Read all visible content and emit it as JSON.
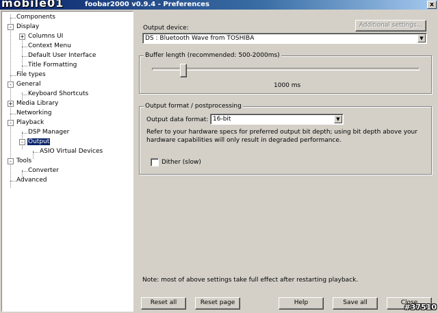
{
  "window": {
    "watermark_logo": "mobile01",
    "title": "foobar2000 v0.9.4 - Preferences",
    "close_label": "x"
  },
  "tree": {
    "items": [
      {
        "label": "Components"
      },
      {
        "label": "Display",
        "expander": "-"
      },
      {
        "label": "Columns UI",
        "expander": "+"
      },
      {
        "label": "Context Menu"
      },
      {
        "label": "Default User Interface"
      },
      {
        "label": "Title Formatting"
      },
      {
        "label": "File types"
      },
      {
        "label": "General",
        "expander": "-"
      },
      {
        "label": "Keyboard Shortcuts"
      },
      {
        "label": "Media Library",
        "expander": "+"
      },
      {
        "label": "Networking"
      },
      {
        "label": "Playback",
        "expander": "-"
      },
      {
        "label": "DSP Manager"
      },
      {
        "label": "Output",
        "expander": "-",
        "selected": true
      },
      {
        "label": "ASIO Virtual Devices"
      },
      {
        "label": "Tools",
        "expander": "-"
      },
      {
        "label": "Converter"
      },
      {
        "label": "Advanced"
      }
    ]
  },
  "output_device": {
    "label": "Output device:",
    "advanced_button": "Additional settings...",
    "value": "DS : Bluetooth Wave from TOSHIBA"
  },
  "buffer": {
    "group_title": "Buffer length (recommended: 500-2000ms)",
    "value_text": "1000 ms",
    "level": 0.25
  },
  "output_format": {
    "group_title": "Output format / postprocessing",
    "format_label": "Output data format:",
    "format_value": "16-bit",
    "hint": "Refer to your hardware specs for preferred output bit depth; using bit depth above your hardware capabilities will only result in degraded performance.",
    "dither_label": "Dither (slow)",
    "dither_checked": false
  },
  "note": "Note: most of above settings take full effect after restarting playback.",
  "buttons": {
    "reset_all": "Reset all",
    "reset_page": "Reset page",
    "help": "Help",
    "save_all": "Save all",
    "close": "Close"
  },
  "corner_watermark": "#37510"
}
